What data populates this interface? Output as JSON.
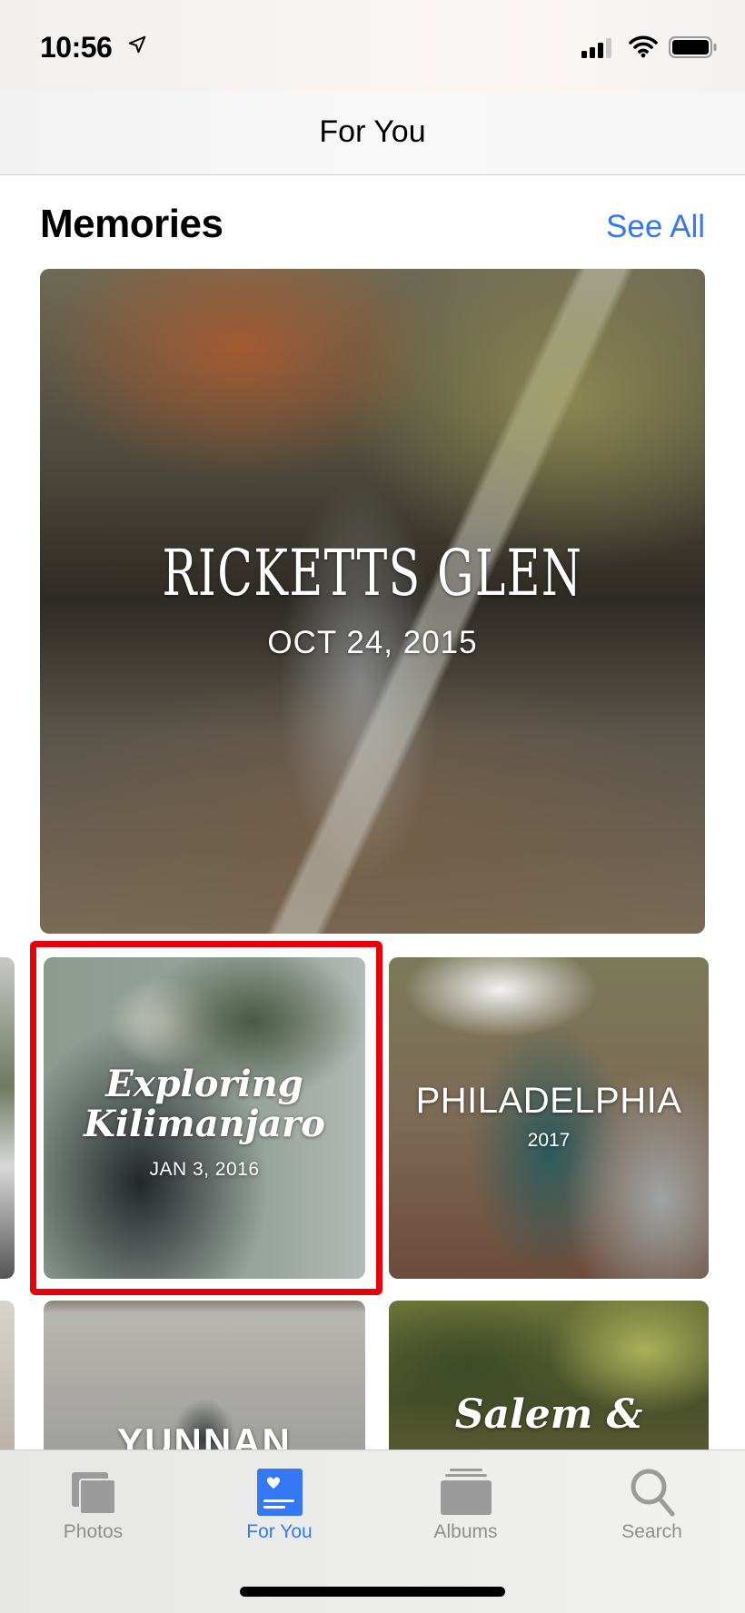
{
  "status_bar": {
    "time": "10:56",
    "icons": [
      "location-arrow-icon",
      "cellular-signal-icon",
      "wifi-icon",
      "battery-icon"
    ]
  },
  "nav": {
    "title": "For You"
  },
  "memories": {
    "section_title": "Memories",
    "see_all_label": "See All",
    "items": [
      {
        "title": "RICKETTS GLEN",
        "subtitle": "OCT 24, 2015"
      },
      {
        "title": "Exploring Kilimanjaro",
        "title_line1": "Exploring",
        "title_line2": "Kilimanjaro",
        "subtitle": "JAN 3, 2016",
        "highlighted": true
      },
      {
        "title": "PHILADELPHIA",
        "subtitle": "2017"
      },
      {
        "title": "YUNNAN",
        "subtitle": ""
      },
      {
        "title": "Salem &",
        "subtitle": ""
      }
    ]
  },
  "highlight_color": "#e8000b",
  "accent_color": "#3478f6",
  "tab_bar": {
    "tabs": [
      {
        "label": "Photos",
        "icon": "photos-stack-icon",
        "active": false
      },
      {
        "label": "For You",
        "icon": "for-you-heart-card-icon",
        "active": true
      },
      {
        "label": "Albums",
        "icon": "albums-stack-icon",
        "active": false
      },
      {
        "label": "Search",
        "icon": "search-icon",
        "active": false
      }
    ]
  }
}
